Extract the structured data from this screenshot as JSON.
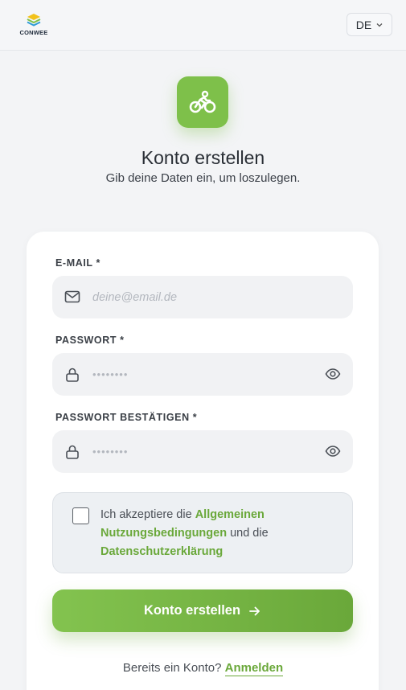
{
  "header": {
    "logo_text": "CONWEE",
    "language": "DE"
  },
  "hero": {
    "icon": "bicycle-icon",
    "title": "Konto erstellen",
    "subtitle": "Gib deine Daten ein, um loszulegen."
  },
  "form": {
    "email_label": "E-MAIL *",
    "email_placeholder": "deine@email.de",
    "password_label": "PASSWORT *",
    "password_placeholder": "••••••••",
    "confirm_label": "PASSWORT BESTÄTIGEN *",
    "confirm_placeholder": "••••••••",
    "terms": {
      "prefix": "Ich akzeptiere die ",
      "link_terms": "Allgemeinen Nutzungsbedingungen",
      "middle": " und die ",
      "link_privacy": "Datenschutzerklärung"
    },
    "submit_label": "Konto erstellen"
  },
  "footer": {
    "question": "Bereits ein Konto?",
    "login_link": "Anmelden"
  },
  "colors": {
    "accent": "#7ec04a",
    "accent_dark": "#6aa83a",
    "background": "#f3f4f6"
  }
}
